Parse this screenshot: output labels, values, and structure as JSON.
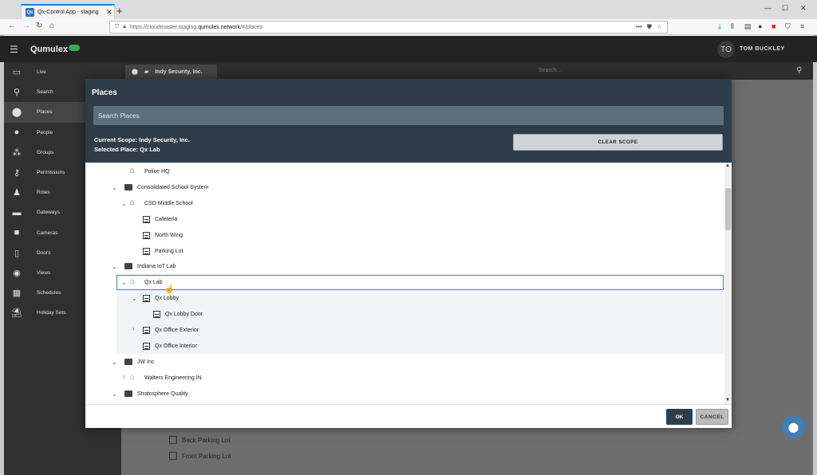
{
  "browser": {
    "tab_title": "Qx-Control App - staging",
    "favicon_text": "Qx",
    "url_prefix": "https://cloudmaster.staging.",
    "url_domain": "qumulex.network",
    "url_suffix": "/#/places"
  },
  "app": {
    "brand": "Qumulex",
    "user_initials": "TO",
    "user_name": "TOM BUCKLEY",
    "accent": "#3aa463"
  },
  "sidebar": {
    "items": [
      {
        "label": "Live",
        "icon": "monitor-icon"
      },
      {
        "label": "Search",
        "icon": "search-icon"
      },
      {
        "label": "Places",
        "icon": "map-pin-icon"
      },
      {
        "label": "People",
        "icon": "person-icon"
      },
      {
        "label": "Groups",
        "icon": "group-icon"
      },
      {
        "label": "Permissions",
        "icon": "key-icon"
      },
      {
        "label": "Roles",
        "icon": "role-icon"
      },
      {
        "label": "Gateways",
        "icon": "gateway-icon"
      },
      {
        "label": "Cameras",
        "icon": "camera-icon"
      },
      {
        "label": "Doors",
        "icon": "door-icon"
      },
      {
        "label": "Views",
        "icon": "eye-icon"
      },
      {
        "label": "Schedules",
        "icon": "calendar-icon"
      },
      {
        "label": "Holiday Sets",
        "icon": "holiday-icon"
      }
    ],
    "active": "Places"
  },
  "background": {
    "scope_chip": "Indy Security, Inc.",
    "search_placeholder": "Search...",
    "items": [
      "Back Parking Lot",
      "Front Parking Lot"
    ]
  },
  "modal": {
    "title": "Places",
    "search_placeholder": "Search Places",
    "current_scope": "Current Scope: Indy Security, Inc.",
    "selected_place": "Selected Place: Qx Lab",
    "clear_scope": "CLEAR SCOPE",
    "ok": "OK",
    "cancel": "CANCEL",
    "tree": [
      {
        "label": "Police HQ",
        "icon": "building-icon"
      },
      {
        "label": "Consolidated School System",
        "icon": "briefcase-icon"
      },
      {
        "label": "CSD Middle School",
        "icon": "building-icon"
      },
      {
        "label": "Cafeteria",
        "icon": "area-icon"
      },
      {
        "label": "North Wing",
        "icon": "area-icon"
      },
      {
        "label": "Parking Lot",
        "icon": "area-icon"
      },
      {
        "label": "Indiana IoT Lab",
        "icon": "briefcase-icon"
      },
      {
        "label": "Qx Lab",
        "icon": "building-green-icon"
      },
      {
        "label": "Qx Lobby",
        "icon": "area-icon"
      },
      {
        "label": "Qx Lobby Door",
        "icon": "area-icon"
      },
      {
        "label": "Qx Office Exterior",
        "icon": "area-icon"
      },
      {
        "label": "Qx Office Interior",
        "icon": "area-icon"
      },
      {
        "label": "JW Inc",
        "icon": "briefcase-icon"
      },
      {
        "label": "Walters Engineering IN",
        "icon": "building-green-icon"
      },
      {
        "label": "Stratosphere Quality",
        "icon": "briefcase-icon"
      }
    ]
  }
}
